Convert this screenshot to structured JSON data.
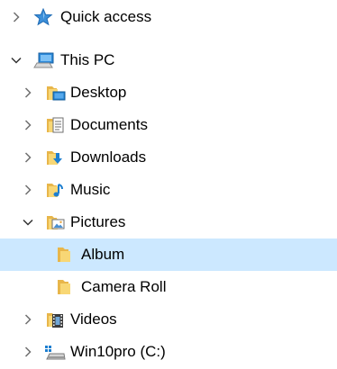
{
  "tree": {
    "quick_access": {
      "label": "Quick access",
      "icon": "star-icon",
      "expanded": false
    },
    "this_pc": {
      "label": "This PC",
      "icon": "computer-icon",
      "expanded": true
    },
    "desktop": {
      "label": "Desktop",
      "icon": "desktop-folder-icon",
      "expanded": false
    },
    "documents": {
      "label": "Documents",
      "icon": "documents-folder-icon",
      "expanded": false
    },
    "downloads": {
      "label": "Downloads",
      "icon": "downloads-folder-icon",
      "expanded": false
    },
    "music": {
      "label": "Music",
      "icon": "music-folder-icon",
      "expanded": false
    },
    "pictures": {
      "label": "Pictures",
      "icon": "pictures-folder-icon",
      "expanded": true
    },
    "album": {
      "label": "Album",
      "icon": "folder-icon",
      "selected": true
    },
    "camera_roll": {
      "label": "Camera Roll",
      "icon": "folder-icon",
      "selected": false
    },
    "videos": {
      "label": "Videos",
      "icon": "videos-folder-icon",
      "expanded": false
    },
    "drive_c": {
      "label": "Win10pro (C:)",
      "icon": "drive-icon",
      "expanded": false
    }
  },
  "colors": {
    "selection": "#cce8ff",
    "folder": "#f8d775",
    "chevron": "#707070"
  }
}
